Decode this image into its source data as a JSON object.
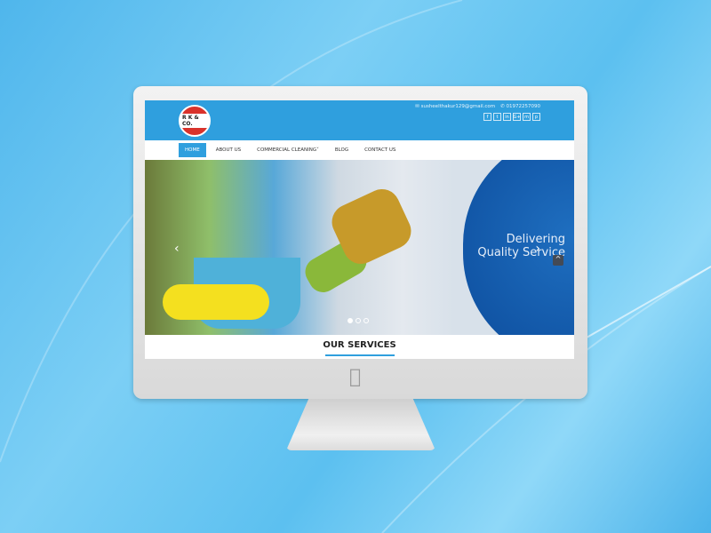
{
  "site": {
    "logo_text": "R K & CO.",
    "email": "susheelthakur129@gmail.com",
    "phone": "01972257090",
    "social": [
      "f",
      "t",
      "in",
      "G+",
      "m",
      "p"
    ],
    "nav": [
      {
        "label": "HOME",
        "active": true
      },
      {
        "label": "ABOUT US"
      },
      {
        "label": "COMMERCIAL CLEANING"
      },
      {
        "label": "BLOG"
      },
      {
        "label": "CONTACT US"
      }
    ],
    "dropdown_marker": "˅",
    "slider": {
      "line1": "Delivering",
      "line2": "Quality Service",
      "prev": "‹",
      "next": "›",
      "slide_count": 3,
      "active_slide": 1
    },
    "to_top": "^",
    "section_title": "OUR SERVICES"
  },
  "device": {
    "logo": ""
  }
}
